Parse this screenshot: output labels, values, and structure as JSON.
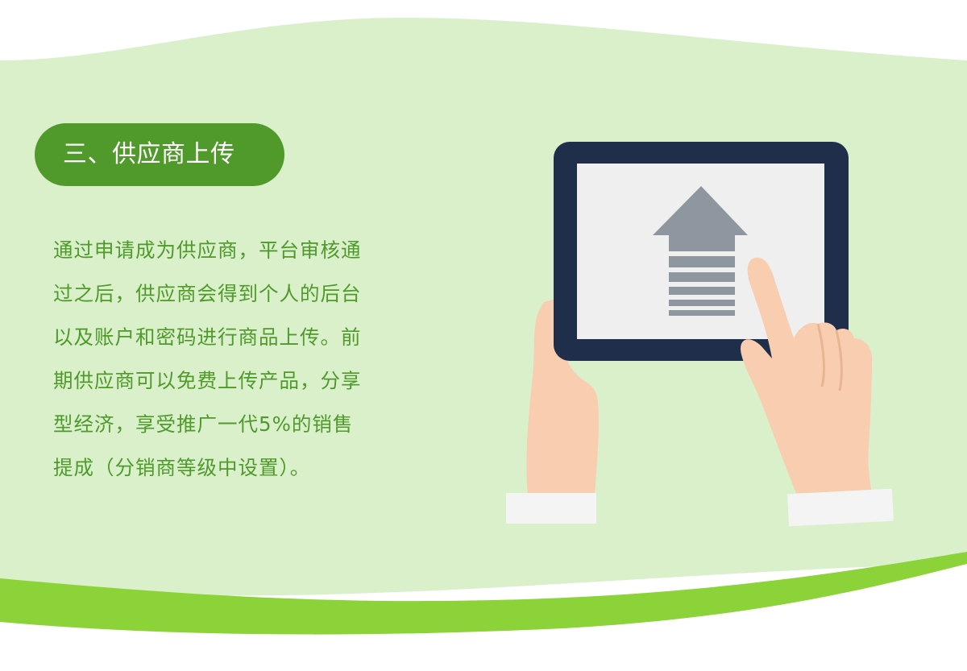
{
  "section": {
    "title": "三、供应商上传"
  },
  "description": {
    "lines": [
      "通过申请成为供应商，平台审核通",
      "过之后，供应商会得到个人的后台",
      "以及账户和密码进行商品上传。前",
      "期供应商可以免费上传产品，分享",
      "型经济，享受推广一代5%的销售",
      "提成（分销商等级中设置）。"
    ]
  },
  "colors": {
    "page_bg": "#ffffff",
    "panel_bg": "#d9f0cb",
    "accent_green": "#4f9a2a",
    "wave_green": "#8cd33a",
    "tablet_frame": "#1f2e4a",
    "tablet_screen": "#efefef",
    "arrow_gray": "#8e979f",
    "skin": "#f8cdb0",
    "cuff": "#f4f4f4"
  },
  "illustration": {
    "icon": "tablet-upload-icon"
  }
}
